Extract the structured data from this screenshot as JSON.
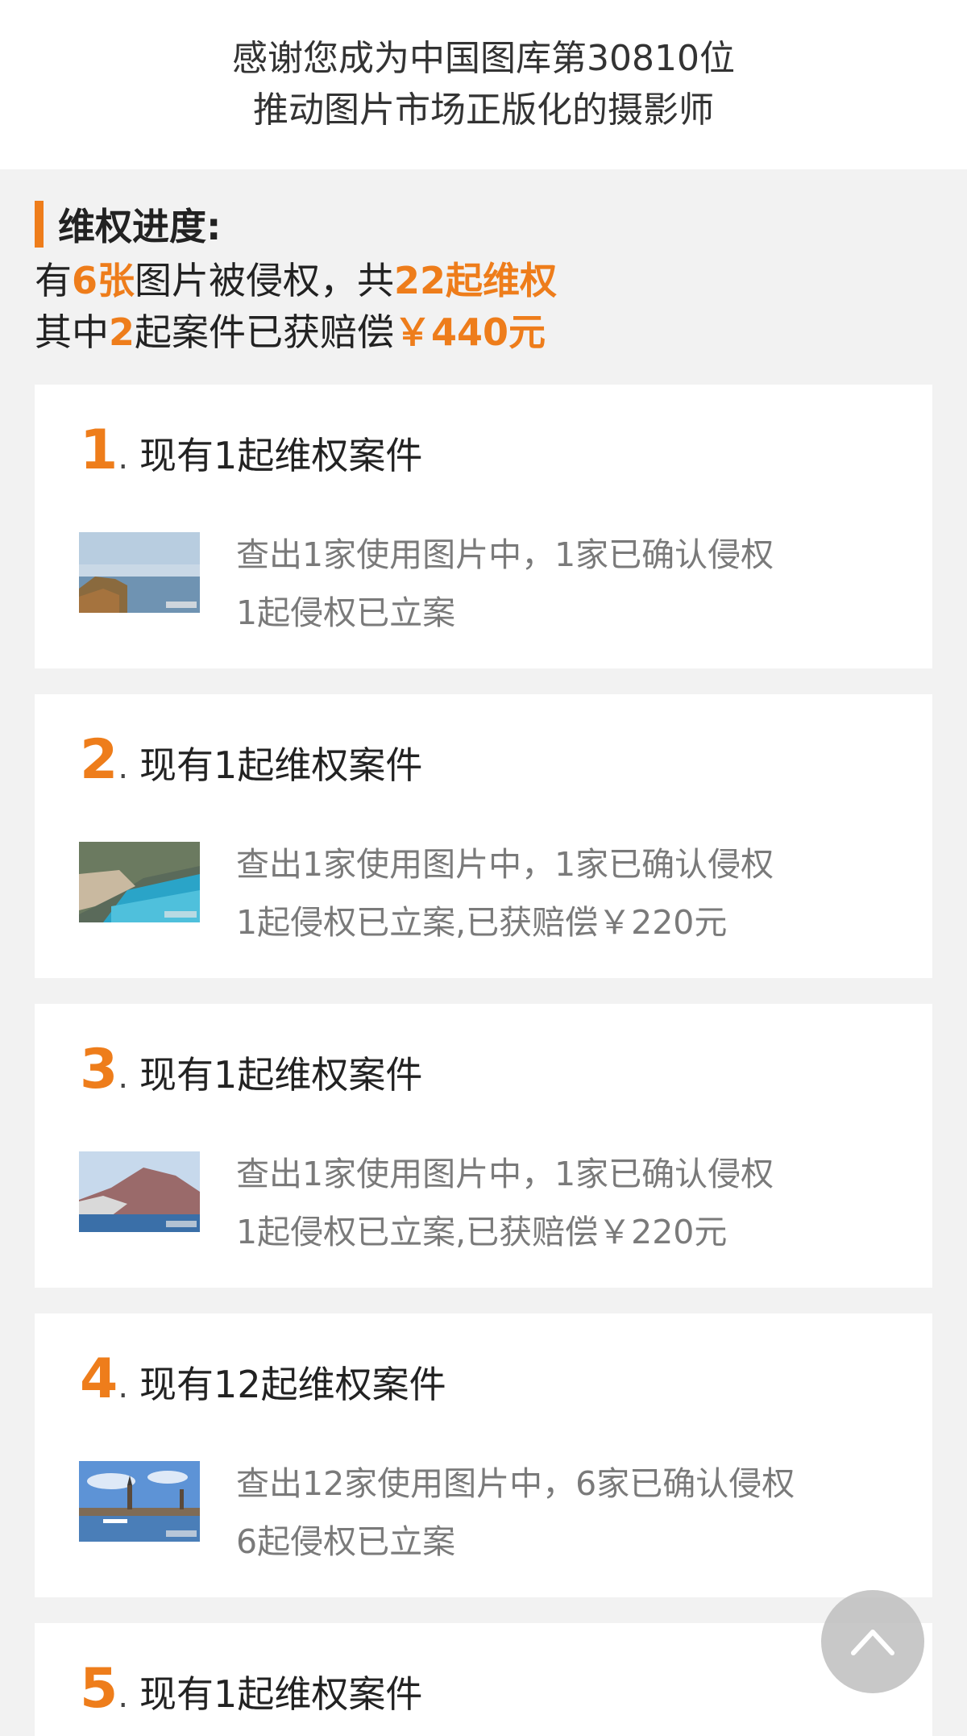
{
  "header": {
    "line1": "感谢您成为中国图库第30810位",
    "line2": "推动图片市场正版化的摄影师"
  },
  "progress": {
    "heading": "维权进度:",
    "l1_a": "有",
    "l1_b": "6张",
    "l1_c": "图片被侵权，共",
    "l1_d": "22起维权",
    "l2_a": "其中",
    "l2_b": "2",
    "l2_c": "起案件已获赔偿",
    "l2_d": "￥440元"
  },
  "cases": [
    {
      "num": "1",
      "title": "现有1起维权案件",
      "line1": "查出1家使用图片中，1家已确认侵权",
      "line2": "1起侵权已立案"
    },
    {
      "num": "2",
      "title": "现有1起维权案件",
      "line1": "查出1家使用图片中，1家已确认侵权",
      "line2": "1起侵权已立案,已获赔偿￥220元"
    },
    {
      "num": "3",
      "title": "现有1起维权案件",
      "line1": "查出1家使用图片中，1家已确认侵权",
      "line2": "1起侵权已立案,已获赔偿￥220元"
    },
    {
      "num": "4",
      "title": "现有12起维权案件",
      "line1": "查出12家使用图片中，6家已确认侵权",
      "line2": "6起侵权已立案"
    },
    {
      "num": "5",
      "title": "现有1起维权案件",
      "line1": "",
      "line2": ""
    }
  ],
  "dot": ".",
  "colors": {
    "accent": "#ee7d1b",
    "page_bg": "#f2f2f2",
    "card_bg": "#ffffff",
    "desc_text": "#7a7a7a"
  },
  "icons": {
    "scroll_top": "chevron-up-icon"
  }
}
